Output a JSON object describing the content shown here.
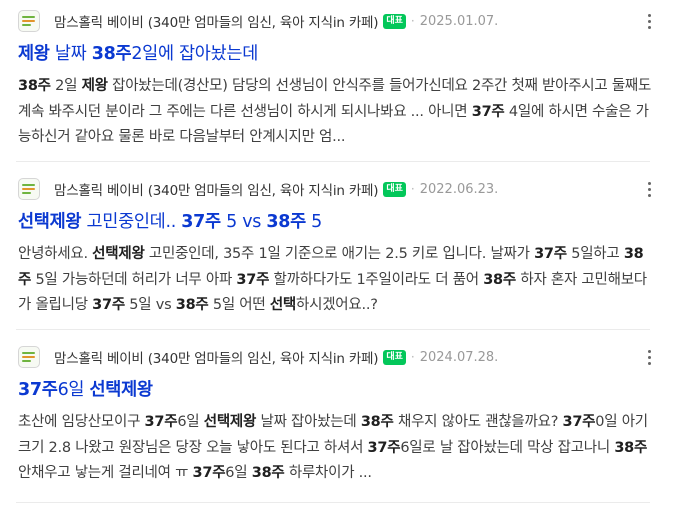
{
  "results": [
    {
      "source": "맘스홀릭 베이비 (340만 엄마들의 임신, 육아 지식in 카페)",
      "badge": "대표",
      "date": "2025.01.07.",
      "title": [
        {
          "t": "제왕",
          "b": true
        },
        {
          "t": " 날짜 ",
          "b": false
        },
        {
          "t": "38주",
          "b": true
        },
        {
          "t": "2일에 잡아놨는데",
          "b": false
        }
      ],
      "snippet": [
        {
          "t": "38주",
          "b": true
        },
        {
          "t": " 2일 ",
          "b": false
        },
        {
          "t": "제왕",
          "b": true
        },
        {
          "t": " 잡아놨는데(경산모) 담당의 선생님이 안식주를 들어가신데요 2주간 첫째 받아주시고 둘째도 계속 봐주시던 분이라 그 주에는 다른 선생님이 하시게 되시나봐요 ... 아니면 ",
          "b": false
        },
        {
          "t": "37주",
          "b": true
        },
        {
          "t": " 4일에 하시면 수술은 가능하신거 같아요 물론 바로 다음날부터 안계시지만 엄...",
          "b": false
        }
      ]
    },
    {
      "source": "맘스홀릭 베이비 (340만 엄마들의 임신, 육아 지식in 카페)",
      "badge": "대표",
      "date": "2022.06.23.",
      "title": [
        {
          "t": "선택제왕",
          "b": true
        },
        {
          "t": " 고민중인데.. ",
          "b": false
        },
        {
          "t": "37주",
          "b": true
        },
        {
          "t": " 5 vs ",
          "b": false
        },
        {
          "t": "38주",
          "b": true
        },
        {
          "t": " 5",
          "b": false
        }
      ],
      "snippet": [
        {
          "t": "안녕하세요. ",
          "b": false
        },
        {
          "t": "선택제왕",
          "b": true
        },
        {
          "t": " 고민중인데, 35주 1일 기준으로 애기는 2.5 키로 입니다. 날짜가 ",
          "b": false
        },
        {
          "t": "37주",
          "b": true
        },
        {
          "t": " 5일하고 ",
          "b": false
        },
        {
          "t": "38주",
          "b": true
        },
        {
          "t": " 5일 가능하던데 허리가 너무 아파 ",
          "b": false
        },
        {
          "t": "37주",
          "b": true
        },
        {
          "t": " 할까하다가도 1주일이라도 더 품어 ",
          "b": false
        },
        {
          "t": "38주",
          "b": true
        },
        {
          "t": " 하자 혼자 고민해보다가 올립니당 ",
          "b": false
        },
        {
          "t": "37주",
          "b": true
        },
        {
          "t": " 5일 vs ",
          "b": false
        },
        {
          "t": "38주",
          "b": true
        },
        {
          "t": " 5일 어떤 ",
          "b": false
        },
        {
          "t": "선택",
          "b": true
        },
        {
          "t": "하시겠어요..?",
          "b": false
        }
      ]
    },
    {
      "source": "맘스홀릭 베이비 (340만 엄마들의 임신, 육아 지식in 카페)",
      "badge": "대표",
      "date": "2024.07.28.",
      "title": [
        {
          "t": "37주",
          "b": true
        },
        {
          "t": "6일 ",
          "b": false
        },
        {
          "t": "선택제왕",
          "b": true
        }
      ],
      "snippet": [
        {
          "t": "초산에 임당산모이구 ",
          "b": false
        },
        {
          "t": "37주",
          "b": true
        },
        {
          "t": "6일 ",
          "b": false
        },
        {
          "t": "선택제왕",
          "b": true
        },
        {
          "t": " 날짜 잡아놨는데 ",
          "b": false
        },
        {
          "t": "38주",
          "b": true
        },
        {
          "t": " 채우지 않아도 괜찮을까요? ",
          "b": false
        },
        {
          "t": "37주",
          "b": true
        },
        {
          "t": "0일 아기크기 2.8 나왔고 원장님은 당장 오늘 낳아도 된다고 하셔서 ",
          "b": false
        },
        {
          "t": "37주",
          "b": true
        },
        {
          "t": "6일로 날 잡아놨는데 막상 잡고나니 ",
          "b": false
        },
        {
          "t": "38주",
          "b": true
        },
        {
          "t": " 안채우고 낳는게 걸리네여 ㅠ ",
          "b": false
        },
        {
          "t": "37주",
          "b": true
        },
        {
          "t": "6일 ",
          "b": false
        },
        {
          "t": "38주",
          "b": true
        },
        {
          "t": " 하루차이가 ...",
          "b": false
        }
      ]
    }
  ]
}
